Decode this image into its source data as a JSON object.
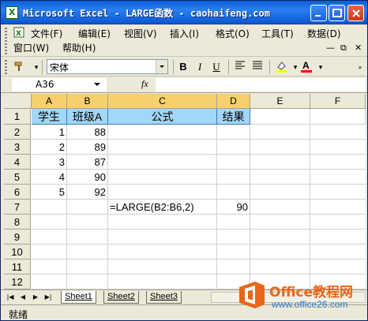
{
  "window": {
    "title": "Microsoft Excel - LARGE函数 - caohaifeng.com"
  },
  "menubar": {
    "items": [
      "文件(F)",
      "编辑(E)",
      "视图(V)",
      "插入(I)",
      "格式(O)",
      "工具(T)",
      "数据(D)"
    ],
    "items_row2": [
      "窗口(W)",
      "帮助(H)"
    ]
  },
  "toolbar": {
    "font_name": "宋体",
    "bold_label": "B",
    "italic_label": "I",
    "underline_label": "U",
    "font_color": "#ff0000",
    "highlight_color": "#ffff00"
  },
  "formula_bar": {
    "name_box": "A36",
    "fx_label": "fx",
    "formula": ""
  },
  "sheet": {
    "columns": [
      "A",
      "B",
      "C",
      "D",
      "E",
      "F"
    ],
    "rows": [
      "1",
      "2",
      "3",
      "4",
      "5",
      "6",
      "7",
      "8",
      "9",
      "10",
      "11",
      "12"
    ],
    "header_row": {
      "A": "学生",
      "B": "班级A",
      "C": "公式",
      "D": "结果"
    },
    "data": [
      {
        "A": "1",
        "B": "88"
      },
      {
        "A": "2",
        "B": "89"
      },
      {
        "A": "3",
        "B": "87"
      },
      {
        "A": "4",
        "B": "90"
      },
      {
        "A": "5",
        "B": "92"
      }
    ],
    "formula_row": {
      "C": "=LARGE(B2:B6,2)",
      "D": "90"
    }
  },
  "tabs": [
    "Sheet1",
    "Sheet2",
    "Sheet3"
  ],
  "active_tab": "Sheet1",
  "status": {
    "text": "就绪"
  },
  "logo": {
    "title": "Office教程网",
    "subtitle": "www.office26.com"
  },
  "colors": {
    "header_fill": "#a3d7f7",
    "selected_col_header": "#f7cf6b",
    "title_bar": "#0a5fd8"
  }
}
